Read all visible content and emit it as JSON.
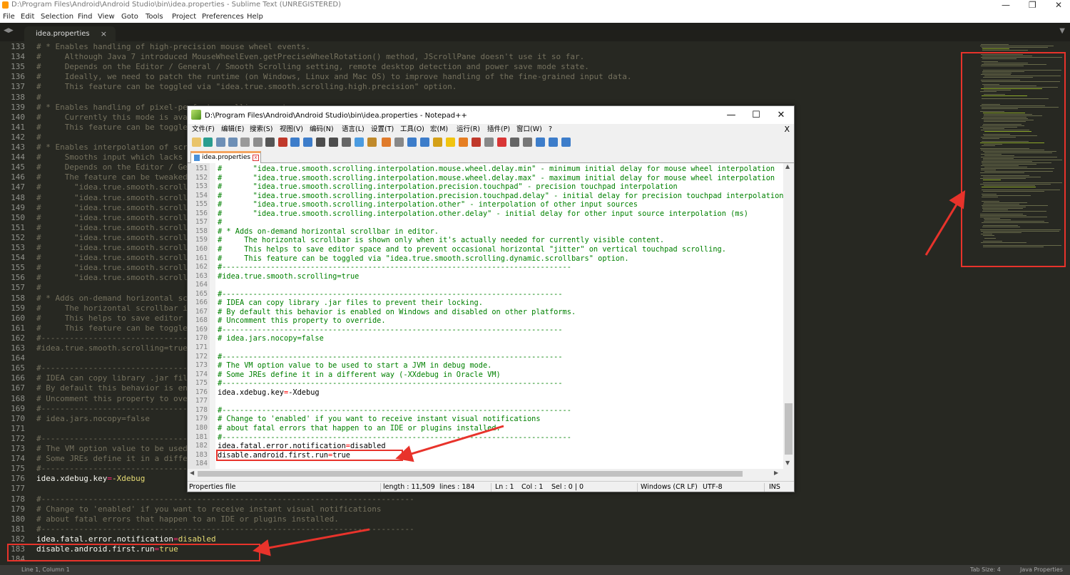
{
  "sublime": {
    "title": "D:\\Program Files\\Android\\Android Studio\\bin\\idea.properties - Sublime Text (UNREGISTERED)",
    "menu": [
      "File",
      "Edit",
      "Selection",
      "Find",
      "View",
      "Goto",
      "Tools",
      "Project",
      "Preferences",
      "Help"
    ],
    "tab": "idea.properties",
    "tab_close": "×",
    "window_controls": [
      "—",
      "❐",
      "✕"
    ],
    "lines": [
      {
        "n": "133",
        "t": "# * Enables handling of high-precision mouse wheel events."
      },
      {
        "n": "134",
        "t": "#     Although Java 7 introduced MouseWheelEven.getPreciseWheelRotation() method, JScrollPane doesn't use it so far."
      },
      {
        "n": "135",
        "t": "#     Depends on the Editor / General / Smooth Scrolling setting, remote desktop detection and power save mode state."
      },
      {
        "n": "136",
        "t": "#     Ideally, we need to patch the runtime (on Windows, Linux and Mac OS) to improve handling of the fine-grained input data."
      },
      {
        "n": "137",
        "t": "#     This feature can be toggled via \"idea.true.smooth.scrolling.high.precision\" option."
      },
      {
        "n": "138",
        "t": "#"
      },
      {
        "n": "139",
        "t": "# * Enables handling of pixel-perfect scrolling events."
      },
      {
        "n": "140",
        "t": "#     Currently this mode is available"
      },
      {
        "n": "141",
        "t": "#     This feature can be toggled"
      },
      {
        "n": "142",
        "t": "#"
      },
      {
        "n": "143",
        "t": "# * Enables interpolation of scro"
      },
      {
        "n": "144",
        "t": "#     Smooths input which lacks b"
      },
      {
        "n": "145",
        "t": "#     Depends on the Editor / Ger"
      },
      {
        "n": "146",
        "t": "#     The feature can be tweaked"
      },
      {
        "n": "147",
        "t": "#       \"idea.true.smooth.scrolli"
      },
      {
        "n": "148",
        "t": "#       \"idea.true.smooth.scrolli"
      },
      {
        "n": "149",
        "t": "#       \"idea.true.smooth.scrolli"
      },
      {
        "n": "150",
        "t": "#       \"idea.true.smooth.scrolli"
      },
      {
        "n": "151",
        "t": "#       \"idea.true.smooth.scrolli"
      },
      {
        "n": "152",
        "t": "#       \"idea.true.smooth.scrolli"
      },
      {
        "n": "153",
        "t": "#       \"idea.true.smooth.scrolli"
      },
      {
        "n": "154",
        "t": "#       \"idea.true.smooth.scrolli"
      },
      {
        "n": "155",
        "t": "#       \"idea.true.smooth.scrolli"
      },
      {
        "n": "156",
        "t": "#       \"idea.true.smooth.scrolli"
      },
      {
        "n": "157",
        "t": "#"
      },
      {
        "n": "158",
        "t": "# * Adds on-demand horizontal scr"
      },
      {
        "n": "159",
        "t": "#     The horizontal scrollbar is"
      },
      {
        "n": "160",
        "t": "#     This helps to save editor s"
      },
      {
        "n": "161",
        "t": "#     This feature can be toggled"
      },
      {
        "n": "162",
        "t": "#-----------------------------------"
      },
      {
        "n": "163",
        "t": "#idea.true.smooth.scrolling=true"
      },
      {
        "n": "164",
        "t": ""
      },
      {
        "n": "165",
        "t": "#-----------------------------------"
      },
      {
        "n": "166",
        "t": "# IDEA can copy library .jar file"
      },
      {
        "n": "167",
        "t": "# By default this behavior is ena"
      },
      {
        "n": "168",
        "t": "# Uncomment this property to over"
      },
      {
        "n": "169",
        "t": "#-----------------------------------"
      },
      {
        "n": "170",
        "t": "# idea.jars.nocopy=false"
      },
      {
        "n": "171",
        "t": ""
      },
      {
        "n": "172",
        "t": "#-----------------------------------"
      },
      {
        "n": "173",
        "t": "# The VM option value to be used"
      },
      {
        "n": "174",
        "t": "# Some JREs define it in a differ"
      },
      {
        "n": "175",
        "t": "#-----------------------------------"
      },
      {
        "n": "176",
        "t": "idea.xdebug.key=-Xdebug",
        "code": true,
        "k": "idea.xdebug.key",
        "v": "-Xdebug"
      },
      {
        "n": "177",
        "t": ""
      },
      {
        "n": "178",
        "t": "#-------------------------------------------------------------------------------"
      },
      {
        "n": "179",
        "t": "# Change to 'enabled' if you want to receive instant visual notifications"
      },
      {
        "n": "180",
        "t": "# about fatal errors that happen to an IDE or plugins installed."
      },
      {
        "n": "181",
        "t": "#-------------------------------------------------------------------------------"
      },
      {
        "n": "182",
        "t": "idea.fatal.error.notification=disabled",
        "code": true,
        "k": "idea.fatal.error.notification",
        "v": "disabled"
      },
      {
        "n": "183",
        "t": "disable.android.first.run=true",
        "code": true,
        "k": "disable.android.first.run",
        "v": "true"
      },
      {
        "n": "184",
        "t": ""
      }
    ],
    "status_left": "Line 1, Column 1",
    "status_tab": "Tab Size: 4",
    "status_syntax": "Java Properties"
  },
  "notepad": {
    "title": "D:\\Program Files\\Android\\Android Studio\\bin\\idea.properties - Notepad++",
    "menu": [
      "文件(F)",
      "编辑(E)",
      "搜索(S)",
      "视图(V)",
      "编码(N)",
      "语言(L)",
      "设置(T)",
      "工具(O)",
      "宏(M)",
      "运行(R)",
      "插件(P)",
      "窗口(W)",
      "?"
    ],
    "close_doc": "X",
    "window_controls": [
      "—",
      "☐",
      "✕"
    ],
    "tab": "idea.properties",
    "lines": [
      {
        "n": "151",
        "t": "#       \"idea.true.smooth.scrolling.interpolation.mouse.wheel.delay.min\" - minimum initial delay for mouse wheel interpolation"
      },
      {
        "n": "152",
        "t": "#       \"idea.true.smooth.scrolling.interpolation.mouse.wheel.delay.max\" - maximum initial delay for mouse wheel interpolation"
      },
      {
        "n": "153",
        "t": "#       \"idea.true.smooth.scrolling.interpolation.precision.touchpad\" - precision touchpad interpolation"
      },
      {
        "n": "154",
        "t": "#       \"idea.true.smooth.scrolling.interpolation.precision.touchpad.delay\" - initial delay for precision touchpad interpolation"
      },
      {
        "n": "155",
        "t": "#       \"idea.true.smooth.scrolling.interpolation.other\" - interpolation of other input sources"
      },
      {
        "n": "156",
        "t": "#       \"idea.true.smooth.scrolling.interpolation.other.delay\" - initial delay for other input source interpolation (ms)"
      },
      {
        "n": "157",
        "t": "#"
      },
      {
        "n": "158",
        "t": "# * Adds on-demand horizontal scrollbar in editor."
      },
      {
        "n": "159",
        "t": "#     The horizontal scrollbar is shown only when it's actually needed for currently visible content."
      },
      {
        "n": "160",
        "t": "#     This helps to save editor space and to prevent occasional horizontal \"jitter\" on vertical touchpad scrolling."
      },
      {
        "n": "161",
        "t": "#     This feature can be toggled via \"idea.true.smooth.scrolling.dynamic.scrollbars\" option."
      },
      {
        "n": "162",
        "t": "#-------------------------------------------------------------------------------"
      },
      {
        "n": "163",
        "t": "#idea.true.smooth.scrolling=true"
      },
      {
        "n": "164",
        "t": ""
      },
      {
        "n": "165",
        "t": "#-----------------------------------------------------------------------------"
      },
      {
        "n": "166",
        "t": "# IDEA can copy library .jar files to prevent their locking."
      },
      {
        "n": "167",
        "t": "# By default this behavior is enabled on Windows and disabled on other platforms."
      },
      {
        "n": "168",
        "t": "# Uncomment this property to override."
      },
      {
        "n": "169",
        "t": "#-----------------------------------------------------------------------------"
      },
      {
        "n": "170",
        "t": "# idea.jars.nocopy=false"
      },
      {
        "n": "171",
        "t": ""
      },
      {
        "n": "172",
        "t": "#-----------------------------------------------------------------------------"
      },
      {
        "n": "173",
        "t": "# The VM option value to be used to start a JVM in debug mode."
      },
      {
        "n": "174",
        "t": "# Some JREs define it in a different way (-XXdebug in Oracle VM)"
      },
      {
        "n": "175",
        "t": "#-----------------------------------------------------------------------------"
      },
      {
        "n": "176",
        "t": "idea.xdebug.key=-Xdebug",
        "code": true,
        "k": "idea.xdebug.key",
        "v": "-Xdebug"
      },
      {
        "n": "177",
        "t": ""
      },
      {
        "n": "178",
        "t": "#-------------------------------------------------------------------------------"
      },
      {
        "n": "179",
        "t": "# Change to 'enabled' if you want to receive instant visual notifications"
      },
      {
        "n": "180",
        "t": "# about fatal errors that happen to an IDE or plugins installed."
      },
      {
        "n": "181",
        "t": "#-------------------------------------------------------------------------------"
      },
      {
        "n": "182",
        "t": "idea.fatal.error.notification=disabled",
        "code": true,
        "k": "idea.fatal.error.notification",
        "v": "disabled"
      },
      {
        "n": "183",
        "t": "disable.android.first.run=true",
        "code": true,
        "k": "disable.android.first.run",
        "v": "true"
      },
      {
        "n": "184",
        "t": ""
      }
    ],
    "status": {
      "type": "Properties file",
      "length": "length : 11,509",
      "lines": "lines : 184",
      "ln": "Ln : 1",
      "col": "Col : 1",
      "sel": "Sel : 0 | 0",
      "eol": "Windows (CR LF)",
      "enc": "UTF-8",
      "ins": "INS"
    }
  },
  "colors": {
    "sublime_bg": "#272822",
    "comment": "#75715e",
    "annotation_red": "#e8332b"
  }
}
